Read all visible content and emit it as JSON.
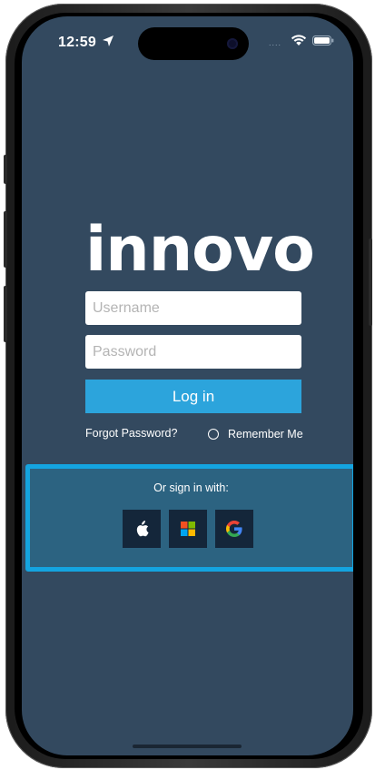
{
  "status_bar": {
    "time": "12:59",
    "signal_dots": "....",
    "icons": [
      "location-arrow-icon",
      "wifi-icon",
      "battery-icon"
    ]
  },
  "login": {
    "logo_text": "innovo",
    "username_placeholder": "Username",
    "username_value": "",
    "password_placeholder": "Password",
    "password_value": "",
    "login_button_label": "Log in",
    "forgot_password_label": "Forgot Password?",
    "remember_me_label": "Remember Me",
    "remember_me_checked": false
  },
  "sso": {
    "title": "Or sign in with:",
    "providers": [
      {
        "name": "Apple",
        "icon": "apple-icon"
      },
      {
        "name": "Microsoft",
        "icon": "microsoft-icon"
      },
      {
        "name": "Google",
        "icon": "google-icon"
      }
    ]
  },
  "colors": {
    "screen_background": "#33495f",
    "login_button": "#2ca4dc",
    "sso_panel_border": "#14a4e0",
    "sso_panel_background": "#2c6381",
    "sso_button_background": "#14263a"
  }
}
